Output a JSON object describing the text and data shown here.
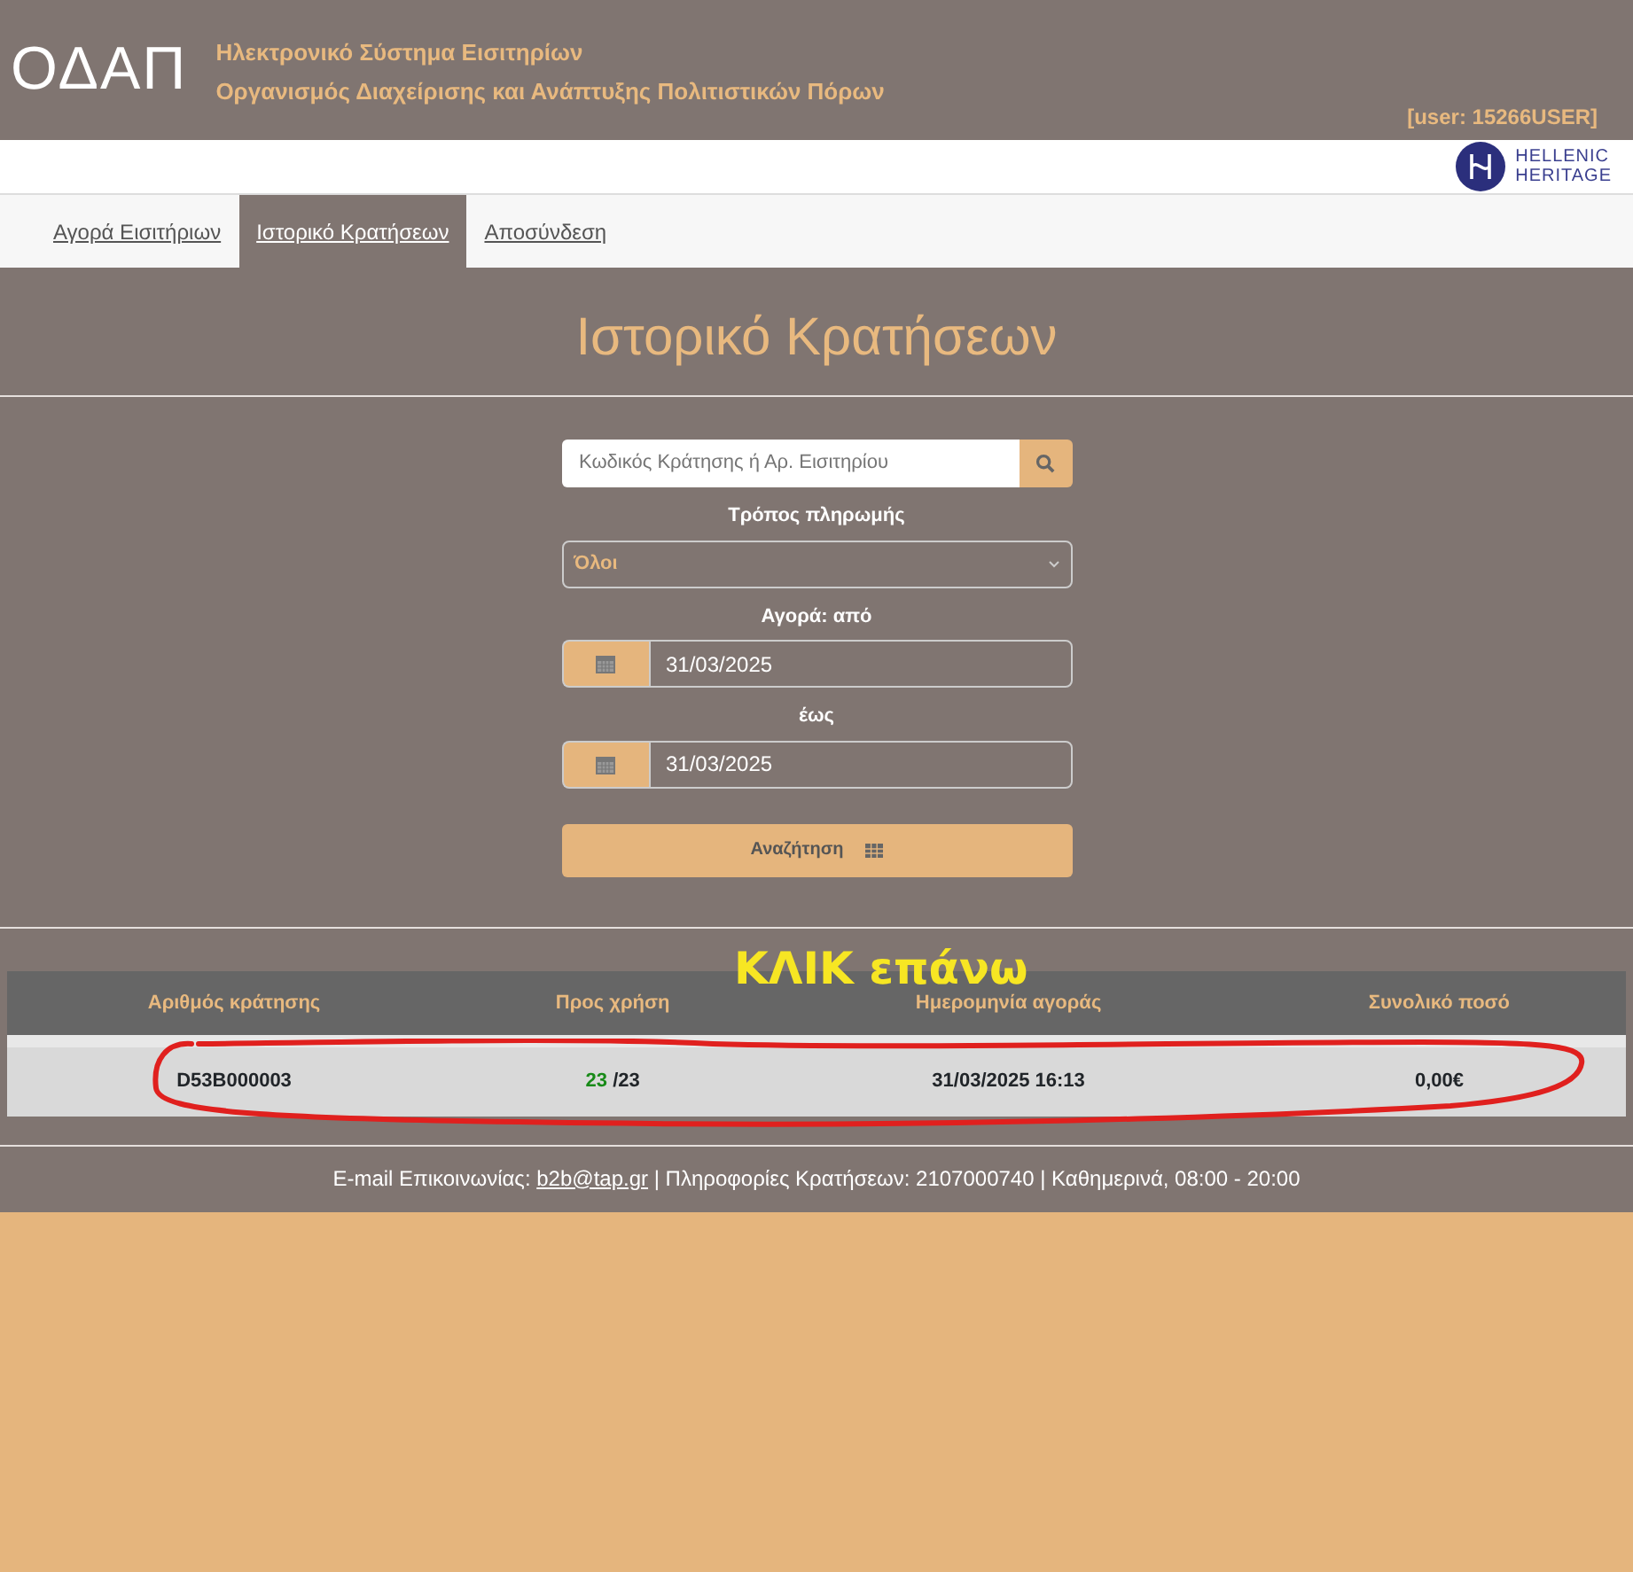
{
  "header": {
    "logo_text": "ΟΔΑΠ",
    "title_line_1": "Ηλεκτρονικό Σύστημα Εισιτηρίων",
    "title_line_2": "Οργανισμός Διαχείρισης και Ανάπτυξης Πολιτιστικών Πόρων",
    "user": "[user: 15266USER]"
  },
  "partner_logo": {
    "line_1": "HELLENIC",
    "line_2": "HERITAGE"
  },
  "tabs": [
    {
      "label": "Αγορά Εισιτήριων",
      "selected": false
    },
    {
      "label": "Ιστορικό Κρατήσεων",
      "selected": true
    },
    {
      "label": "Αποσύνδεση",
      "selected": false
    }
  ],
  "page_title": "Ιστορικό Κρατήσεων",
  "form": {
    "search": {
      "placeholder": "Κωδικός Κράτησης ή Αρ. Εισιτηρίου"
    },
    "payment_label": "Τρόπος πληρωμής",
    "payment_value": "Όλοι",
    "from_label": "Αγορά: από",
    "from_value": "31/03/2025",
    "to_label": "έως",
    "to_value": "31/03/2025",
    "submit": "Αναζήτηση"
  },
  "table": {
    "columns": [
      "Αριθμός κράτησης",
      "Προς χρήση",
      "Ημερομηνία αγοράς",
      "Συνολικό ποσό"
    ],
    "rows": [
      {
        "booking": "D53B000003",
        "remaining": "23",
        "total_tickets": "/23",
        "date": "31/03/2025 16:13",
        "amount": "0,00€"
      }
    ]
  },
  "annotation": {
    "text": "ΚΛΙΚ επάνω"
  },
  "footer": {
    "prefix": "E-mail Επικοινωνίας: ",
    "email": "b2b@tap.gr",
    "suffix": " | Πληροφορίες Κρατήσεων: 2107000740 | Καθημερινά, 08:00 - 20:00"
  }
}
